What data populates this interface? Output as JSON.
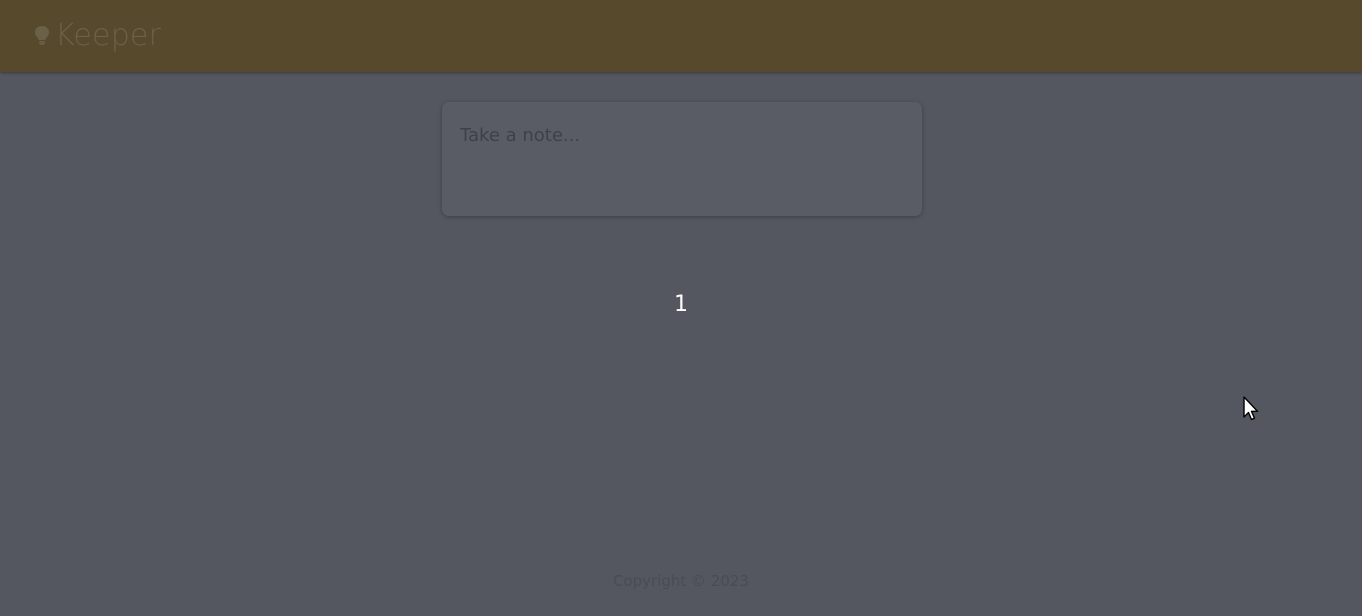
{
  "header": {
    "title": "Keeper",
    "logo_icon": "lightbulb-icon",
    "background_color": "#574a2c"
  },
  "note_form": {
    "placeholder": "Take a note...",
    "value": ""
  },
  "main": {
    "count": "1"
  },
  "footer": {
    "text": "Copyright © 2023"
  },
  "colors": {
    "page_background": "#555760",
    "counter_text": "#ffffff"
  }
}
